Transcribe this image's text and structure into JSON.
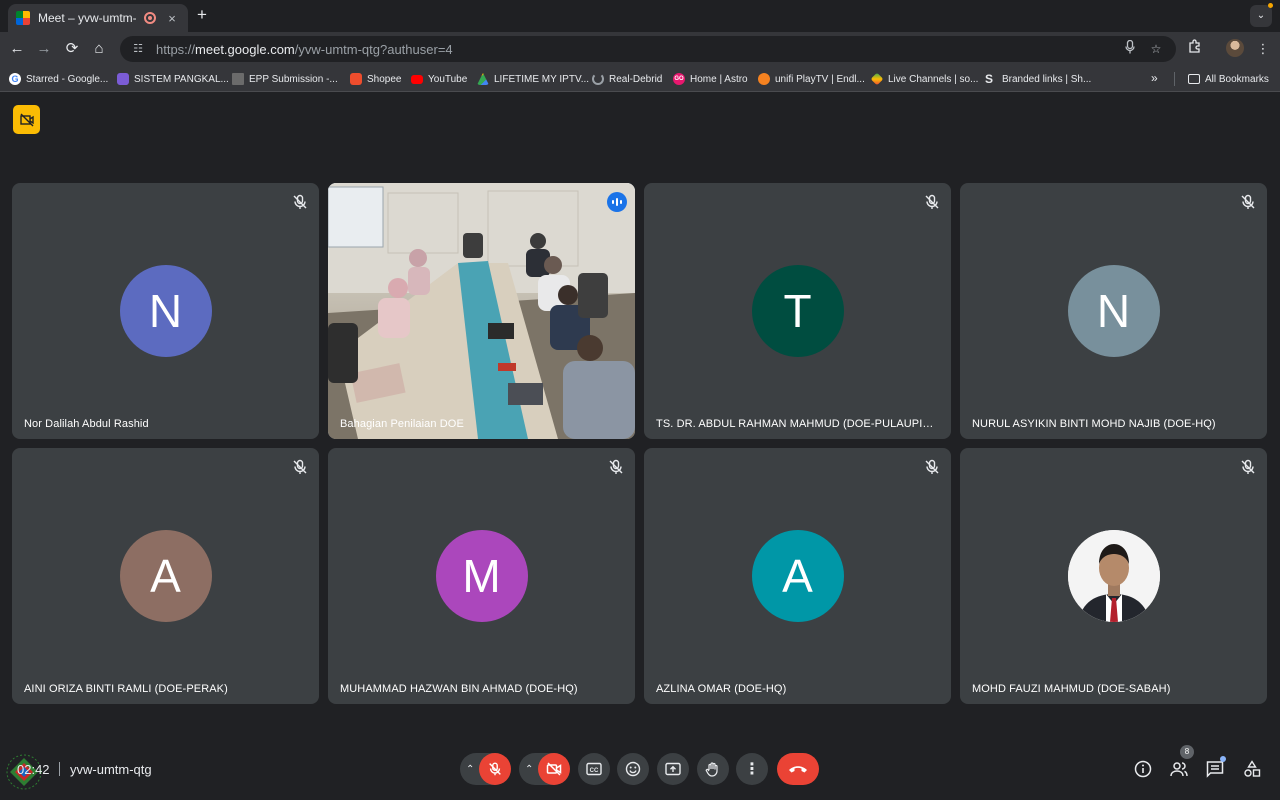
{
  "browser": {
    "tab_title": "Meet – yvw-umtm-qtg",
    "tab_close": "×",
    "new_tab": "+",
    "url_scheme": "https://",
    "url_host": "meet.google.com",
    "url_path": "/yvw-umtm-qtg?authuser=4",
    "bookmarks": [
      {
        "label": "Starred - Google...",
        "icon": "google-icon",
        "color": "#ffffff"
      },
      {
        "label": "SISTEM PANGKAL...",
        "icon": "list-icon",
        "color": "#7b5cd6"
      },
      {
        "label": "EPP Submission -...",
        "icon": "building-icon",
        "color": "#6b6b6b"
      },
      {
        "label": "Shopee",
        "icon": "shopee-icon",
        "color": "#ee4d2d"
      },
      {
        "label": "YouTube",
        "icon": "youtube-icon",
        "color": "#ff0000"
      },
      {
        "label": "LIFETIME MY IPTV...",
        "icon": "drive-icon",
        "color": "#34a853"
      },
      {
        "label": "Real-Debrid",
        "icon": "spinner-icon",
        "color": "#9aa0a6"
      },
      {
        "label": "Home | Astro",
        "icon": "go-icon",
        "color": "#e8176e"
      },
      {
        "label": "unifi PlayTV | Endl...",
        "icon": "unifi-icon",
        "color": "#f58220"
      },
      {
        "label": "Live Channels | so...",
        "icon": "diamond-icon",
        "color": "#34a853"
      },
      {
        "label": "Branded links | Sh...",
        "icon": "s-icon",
        "color": "#e8eaed"
      }
    ],
    "bookmarks_more": "»",
    "all_bookmarks": "All Bookmarks"
  },
  "meet": {
    "participants": [
      {
        "name": "Nor Dalilah Abdul Rashid",
        "initial": "N",
        "color": "#5c6bc0",
        "muted": true
      },
      {
        "name": "Bahagian Penilaian DOE",
        "initial": "",
        "color": "",
        "muted": false,
        "speaking": true,
        "video": true
      },
      {
        "name": "TS. DR. ABDUL RAHMAN MAHMUD (DOE-PULAUPINA...",
        "initial": "T",
        "color": "#004d40",
        "muted": true
      },
      {
        "name": "NURUL ASYIKIN BINTI MOHD NAJIB (DOE-HQ)",
        "initial": "N",
        "color": "#78909c",
        "muted": true
      },
      {
        "name": "AINI ORIZA BINTI RAMLI (DOE-PERAK)",
        "initial": "A",
        "color": "#8d6e63",
        "muted": true
      },
      {
        "name": "MUHAMMAD HAZWAN BIN AHMAD (DOE-HQ)",
        "initial": "M",
        "color": "#ab47bc",
        "muted": true
      },
      {
        "name": "AZLINA OMAR (DOE-HQ)",
        "initial": "A",
        "color": "#0097a7",
        "muted": true
      },
      {
        "name": "MOHD FAUZI MAHMUD (DOE-SABAH)",
        "initial": "",
        "color": "",
        "muted": true,
        "photo": true
      }
    ],
    "time": "02:42",
    "meeting_code": "yvw-umtm-qtg",
    "people_count": "8"
  }
}
